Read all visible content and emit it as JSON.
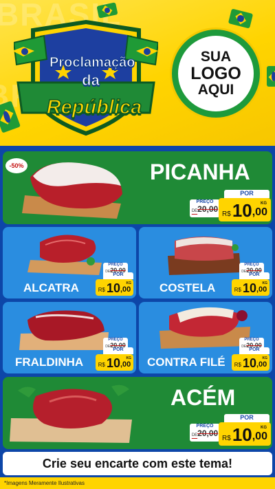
{
  "header": {
    "title_line1": "Proclamação",
    "title_line2": "da",
    "title_line3": "República",
    "bg_word": "BRASIL",
    "logo": {
      "line1": "SUA",
      "line2": "LOGO",
      "line3": "AQUI"
    }
  },
  "products": [
    {
      "name": "PICANHA",
      "discount": "-50%",
      "preco_label": "PREÇO",
      "old_prefix": "DE",
      "old_price": "20,00",
      "por_label": "POR",
      "currency": "R$",
      "price_int": "10",
      "price_dec": ",00",
      "unit": "KG"
    },
    {
      "name": "ALCATRA",
      "preco_label": "PREÇO",
      "old_prefix": "DE",
      "old_price": "20,00",
      "por_label": "POR",
      "currency": "R$",
      "price_int": "10",
      "price_dec": ",00",
      "unit": "KG"
    },
    {
      "name": "COSTELA",
      "preco_label": "PREÇO",
      "old_prefix": "DE",
      "old_price": "20,00",
      "por_label": "POR",
      "currency": "R$",
      "price_int": "10",
      "price_dec": ",00",
      "unit": "KG"
    },
    {
      "name": "FRALDINHA",
      "preco_label": "PREÇO",
      "old_prefix": "DE",
      "old_price": "20,00",
      "por_label": "POR",
      "currency": "R$",
      "price_int": "10",
      "price_dec": ",00",
      "unit": "KG"
    },
    {
      "name": "CONTRA FILÉ",
      "preco_label": "PREÇO",
      "old_prefix": "DE",
      "old_price": "20,00",
      "por_label": "POR",
      "currency": "R$",
      "price_int": "10",
      "price_dec": ",00",
      "unit": "KG"
    },
    {
      "name": "ACÉM",
      "preco_label": "PREÇO",
      "old_prefix": "DE",
      "old_price": "20,00",
      "por_label": "POR",
      "currency": "R$",
      "price_int": "10",
      "price_dec": ",00",
      "unit": "KG"
    }
  ],
  "cta": "Crie seu encarte com este tema!",
  "disclaimer": "*Imagens Meramente Ilustrativas",
  "colors": {
    "yellow": "#ffd400",
    "green": "#1f8a36",
    "blue_card": "#2a8de0",
    "navy": "#0d46a8"
  }
}
